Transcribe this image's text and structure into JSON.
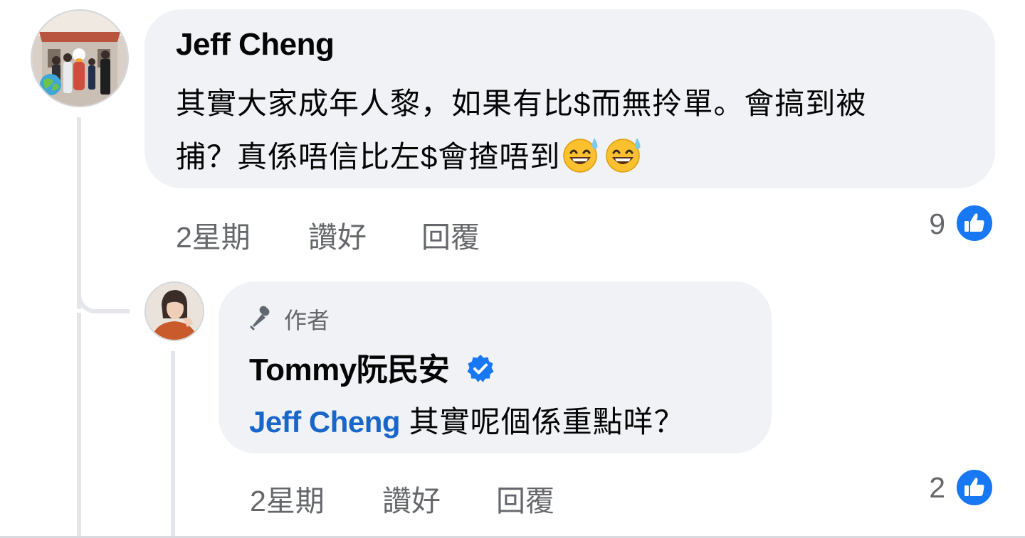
{
  "comment": {
    "author": "Jeff Cheng",
    "text_line1": "其實大家成年人黎，如果有比$而無拎單。會搞到被",
    "text_line2": "捕？真係唔信比左$會揸唔到",
    "emoji": "grinning-face-with-sweat",
    "time": "2星期",
    "like_label": "讚好",
    "reply_label": "回覆",
    "like_count": "9"
  },
  "reply": {
    "author_badge": "作者",
    "author": "Tommy阮民安",
    "verified": true,
    "mention": "Jeff Cheng",
    "text": " 其實呢個係重點咩？",
    "time": "2星期",
    "like_label": "讚好",
    "reply_label": "回覆",
    "like_count": "2"
  },
  "icons": {
    "like": "thumbs-up-icon",
    "verified": "verified-badge-icon",
    "author": "microphone-icon"
  },
  "colors": {
    "bubble": "#f0f2f5",
    "link": "#1866c9",
    "meta_text": "#65676b",
    "like_blue": "#1877f2"
  }
}
